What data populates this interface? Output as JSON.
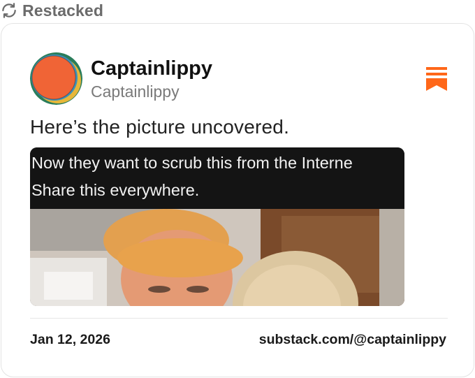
{
  "header": {
    "restacked_label": "Restacked",
    "icon": "restack-icon"
  },
  "post": {
    "author_name": "Captainlippy",
    "author_handle": "Captainlippy",
    "text": "Here’s the picture uncovered.",
    "image_caption_lines": [
      "Now they want to scrub this from the Interne",
      "Share this everywhere."
    ],
    "date": "Jan 12, 2026",
    "url": "substack.com/@captainlippy"
  },
  "icons": {
    "avatar": "avatar-icon",
    "publication_logo": "substack-logo-icon"
  },
  "colors": {
    "accent": "#ff6719",
    "text_primary": "#111111",
    "text_secondary": "#7a7a7a",
    "border": "#e3e3e3"
  }
}
